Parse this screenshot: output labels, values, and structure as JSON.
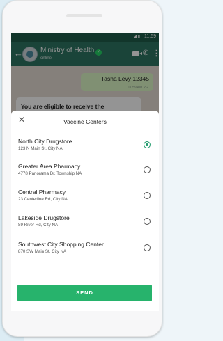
{
  "status_bar": {
    "time": "11:59",
    "signal": "◢ ▮"
  },
  "chat": {
    "back_icon": "arrow-left",
    "title": "Ministry of Health",
    "subtitle": "online",
    "verified_icon": "verified-badge",
    "actions": [
      "video-call-icon",
      "phone-icon",
      "more-vert-icon"
    ]
  },
  "messages": {
    "outgoing": {
      "text": "Tasha Levy 12345",
      "time": "11:59 AM ✓✓"
    },
    "incoming": {
      "text": "You are eligible to receive the"
    }
  },
  "sheet": {
    "close_icon": "✕",
    "title": "Vaccine Centers",
    "options": [
      {
        "name": "North City Drugstore",
        "address": "123 N Main St, City NA",
        "selected": true
      },
      {
        "name": "Greater Area Pharmacy",
        "address": "4778 Panorama Dr, Township NA",
        "selected": false
      },
      {
        "name": "Central Pharmacy",
        "address": "23 Centerline Rd, City NA",
        "selected": false
      },
      {
        "name": "Lakeside Drugstore",
        "address": "89 River Rd, City NA",
        "selected": false
      },
      {
        "name": "Southwest City Shopping Center",
        "address": "870 SW Main St, City NA",
        "selected": false
      }
    ],
    "send_label": "SEND"
  },
  "colors": {
    "header": "#2e7563",
    "accent": "#27b36c",
    "radio_selected": "#1f9a6b",
    "outgoing_bubble": "#dcf8c6"
  }
}
